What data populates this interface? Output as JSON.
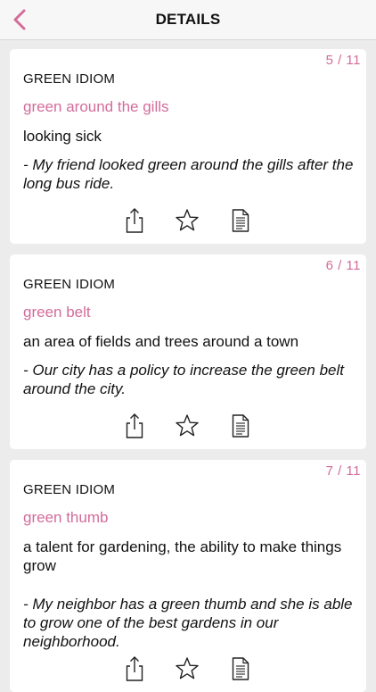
{
  "header": {
    "title": "DETAILS",
    "back_icon": "chevron-left-icon",
    "accent_color": "#d36c9a"
  },
  "cards": [
    {
      "counter": "5 / 11",
      "category": "GREEN IDIOM",
      "idiom": "green around the gills",
      "meaning": "looking sick",
      "example": "- My friend looked green around the gills after the long bus ride.",
      "actions": [
        "share-icon",
        "star-icon",
        "document-icon"
      ]
    },
    {
      "counter": "6 / 11",
      "category": "GREEN IDIOM",
      "idiom": "green belt",
      "meaning": "an area of fields and trees around a town",
      "example": "- Our city has a policy to increase the green belt around the city.",
      "actions": [
        "share-icon",
        "star-icon",
        "document-icon"
      ]
    },
    {
      "counter": "7 / 11",
      "category": "GREEN IDIOM",
      "idiom": "green thumb",
      "meaning": "a talent for gardening, the ability to make things grow",
      "example": "- My neighbor has a green thumb and she is able to grow one of the best gardens in our neighborhood.",
      "actions": [
        "share-icon",
        "star-icon",
        "document-icon"
      ]
    }
  ]
}
